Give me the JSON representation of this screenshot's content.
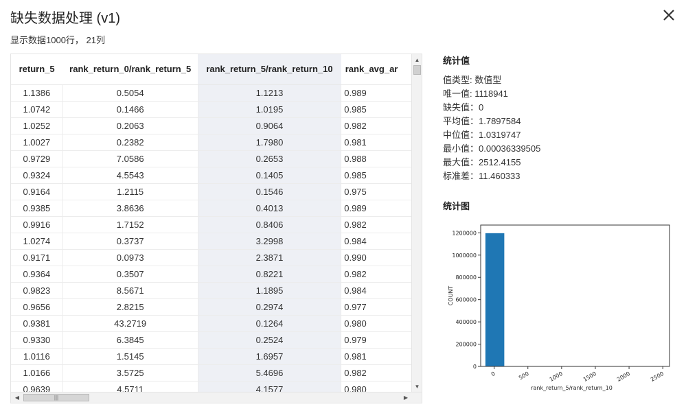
{
  "dialog": {
    "title": "缺失数据处理 (v1)",
    "subtitle": "显示数据1000行， 21列",
    "close_icon": "close-icon"
  },
  "table": {
    "columns": [
      "return_5",
      "rank_return_0/rank_return_5",
      "rank_return_5/rank_return_10",
      "rank_avg_ar"
    ],
    "selected_column": 2,
    "rows": [
      [
        "1.1386",
        "0.5054",
        "1.1213",
        "0.989"
      ],
      [
        "1.0742",
        "0.1466",
        "1.0195",
        "0.985"
      ],
      [
        "1.0252",
        "0.2063",
        "0.9064",
        "0.982"
      ],
      [
        "1.0027",
        "0.2382",
        "1.7980",
        "0.981"
      ],
      [
        "0.9729",
        "7.0586",
        "0.2653",
        "0.988"
      ],
      [
        "0.9324",
        "4.5543",
        "0.1405",
        "0.985"
      ],
      [
        "0.9164",
        "1.2115",
        "0.1546",
        "0.975"
      ],
      [
        "0.9385",
        "3.8636",
        "0.4013",
        "0.989"
      ],
      [
        "0.9916",
        "1.7152",
        "0.8406",
        "0.982"
      ],
      [
        "1.0274",
        "0.3737",
        "3.2998",
        "0.984"
      ],
      [
        "0.9171",
        "0.0973",
        "2.3871",
        "0.990"
      ],
      [
        "0.9364",
        "0.3507",
        "0.8221",
        "0.982"
      ],
      [
        "0.9823",
        "8.5671",
        "1.1895",
        "0.984"
      ],
      [
        "0.9656",
        "2.8215",
        "0.2974",
        "0.977"
      ],
      [
        "0.9381",
        "43.2719",
        "0.1264",
        "0.980"
      ],
      [
        "0.9330",
        "6.3845",
        "0.2524",
        "0.979"
      ],
      [
        "1.0116",
        "1.5145",
        "1.6957",
        "0.981"
      ],
      [
        "1.0166",
        "3.5725",
        "5.4696",
        "0.982"
      ],
      [
        "0.9639",
        "4.5711",
        "4.1577",
        "0.980"
      ]
    ]
  },
  "stats": {
    "title": "统计值",
    "items": [
      "值类型: 数值型",
      "唯一值: 1118941",
      "缺失值：0",
      "平均值：1.7897584",
      "中位值：1.0319747",
      "最小值：0.00036339505",
      "最大值：2512.4155",
      "标准差：11.460333"
    ]
  },
  "chart_section": {
    "title": "统计图"
  },
  "chart_data": {
    "type": "bar",
    "title": "",
    "xlabel": "rank_return_5/rank_return_10",
    "ylabel": "COUNT",
    "x_ticks": [
      "0",
      "500",
      "1000",
      "1500",
      "2000",
      "2500"
    ],
    "y_ticks": [
      "0",
      "200000",
      "400000",
      "600000",
      "800000",
      "1000000",
      "1200000"
    ],
    "xlim": [
      -200,
      2600
    ],
    "ylim": [
      0,
      1270000
    ],
    "bins": [
      {
        "x0": -130,
        "x1": 150,
        "count": 1197000
      }
    ],
    "bar_color": "#1f77b4"
  }
}
